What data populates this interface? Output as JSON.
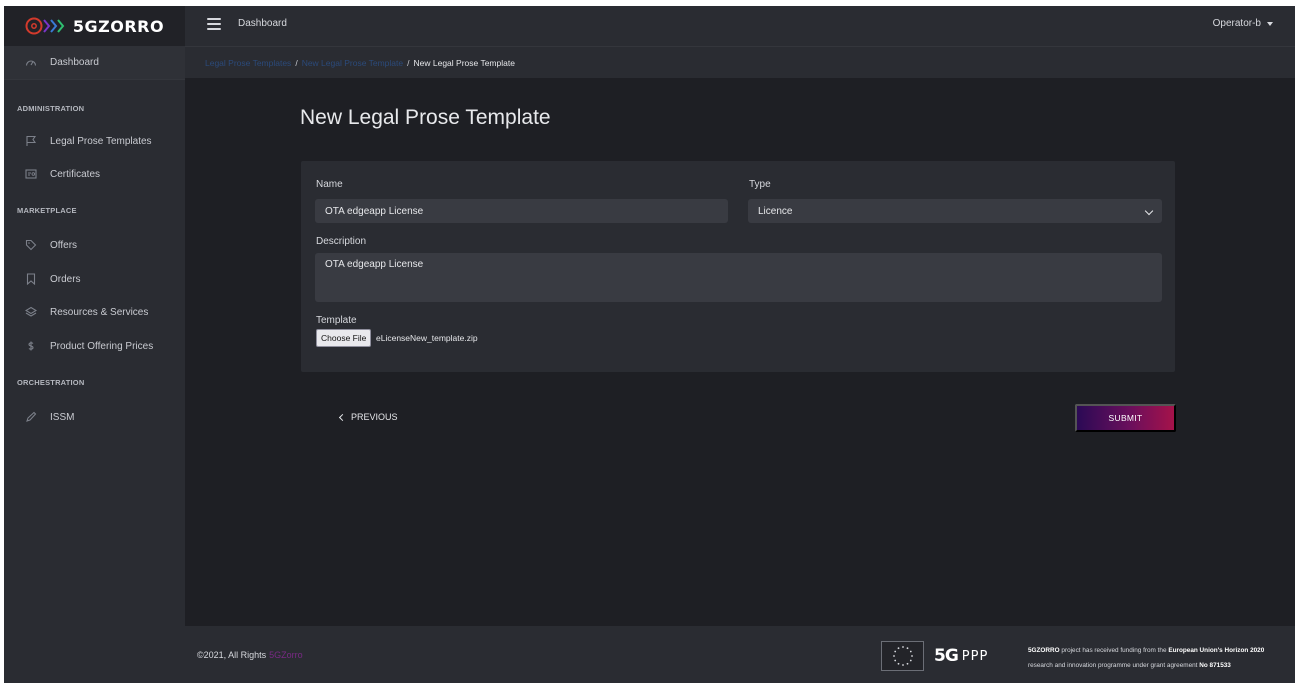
{
  "brand": {
    "name": "5GZORRO"
  },
  "header": {
    "dashboard_link": "Dashboard",
    "user": "Operator-b"
  },
  "breadcrumb": {
    "items": [
      "Legal Prose Templates",
      "New Legal Prose Template"
    ],
    "separator": "/",
    "active": "New Legal Prose Template"
  },
  "sidebar": {
    "dashboard": {
      "label": "Dashboard",
      "icon": "speedometer-icon"
    },
    "sections": [
      {
        "title": "ADMINISTRATION",
        "items": [
          {
            "label": "Legal Prose Templates",
            "icon": "flag-icon"
          },
          {
            "label": "Certificates",
            "icon": "certificate-icon"
          }
        ]
      },
      {
        "title": "MARKETPLACE",
        "items": [
          {
            "label": "Offers",
            "icon": "tag-icon"
          },
          {
            "label": "Orders",
            "icon": "bookmark-icon"
          },
          {
            "label": "Resources & Services",
            "icon": "layers-icon"
          },
          {
            "label": "Product Offering Prices",
            "icon": "dollar-icon"
          }
        ]
      },
      {
        "title": "ORCHESTRATION",
        "items": [
          {
            "label": "ISSM",
            "icon": "pen-icon"
          }
        ]
      }
    ]
  },
  "main": {
    "title": "New Legal Prose Template",
    "form": {
      "name_label": "Name",
      "name_value": "OTA edgeapp License",
      "type_label": "Type",
      "type_value": "Licence",
      "description_label": "Description",
      "description_value": "OTA edgeapp License",
      "template_label": "Template",
      "file_button": "Choose File",
      "file_name": "eLicenseNew_template.zip"
    },
    "previous_button": "PREVIOUS",
    "submit_button": "SUBMIT"
  },
  "footer": {
    "copyright": "©2021, All Rights",
    "copyright_brand": "5GZorro",
    "ppp_mark": "5G",
    "ppp_text": "PPP",
    "funding_parts": [
      "5GZORRO",
      " project has received funding from the ",
      "European Union's Horizon 2020",
      " research and innovation programme under grant agreement ",
      "No 871533"
    ]
  },
  "colors": {
    "background": "#1e1f24",
    "panel": "#2a2c32",
    "input": "#393b42",
    "submit_gradient_start": "#2b0a55",
    "submit_gradient_end": "#a5124a",
    "breadcrumb_link": "#2b4a7a"
  }
}
